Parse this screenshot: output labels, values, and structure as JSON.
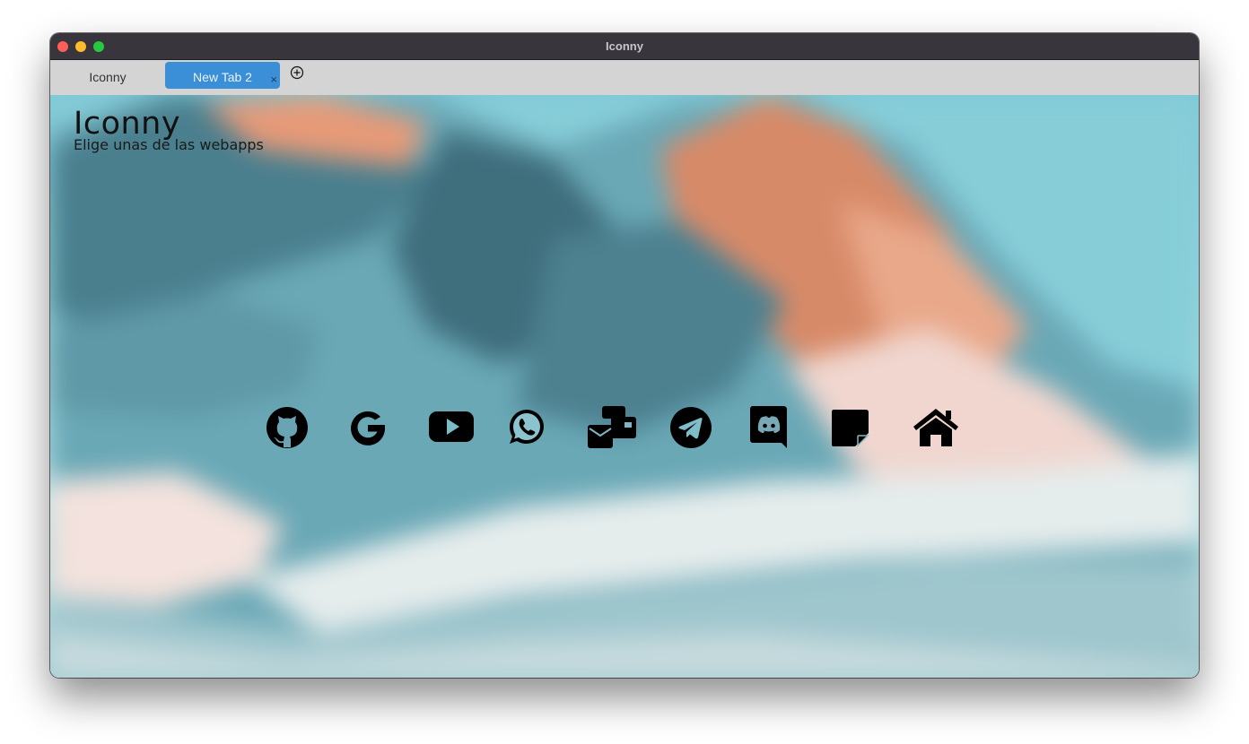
{
  "window": {
    "title": "Iconny"
  },
  "tabs": [
    {
      "label": "Iconny",
      "active": false
    },
    {
      "label": "New Tab 2",
      "active": true,
      "close": "×"
    }
  ],
  "page": {
    "title": "Iconny",
    "subtitle": "Elige unas de las webapps"
  },
  "apps": [
    {
      "icon": "github-icon"
    },
    {
      "icon": "google-icon"
    },
    {
      "icon": "youtube-icon"
    },
    {
      "icon": "whatsapp-icon"
    },
    {
      "icon": "mail-messages-icon"
    },
    {
      "icon": "telegram-icon"
    },
    {
      "icon": "discord-icon"
    },
    {
      "icon": "sticky-note-icon"
    },
    {
      "icon": "home-icon"
    }
  ],
  "colors": {
    "titlebar": "#38353c",
    "active_tab": "#3b8fd6",
    "tabbar": "#d4d4d4",
    "icons": "#000000"
  }
}
